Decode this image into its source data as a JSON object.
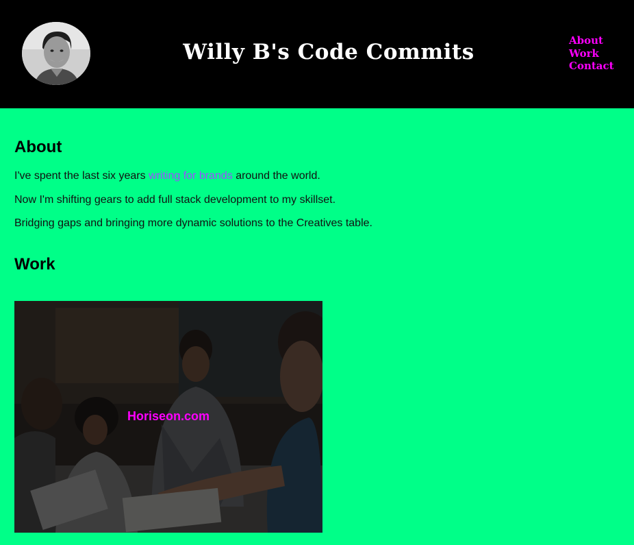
{
  "header": {
    "title": "Willy B's Code Commits",
    "avatar_icon": "profile-photo",
    "nav": [
      {
        "label": "About"
      },
      {
        "label": "Work"
      },
      {
        "label": "Contact"
      }
    ]
  },
  "about": {
    "heading": "About",
    "line1_before": "I've spent the last six years ",
    "line1_link": "writing for brands",
    "line1_after": " around the world.",
    "line2": "Now I'm shifting gears to add full stack development to my skillset.",
    "line3": "Bridging gaps and bringing more dynamic solutions to the Creatives table."
  },
  "work": {
    "heading": "Work",
    "cards": [
      {
        "label": "Horiseon.com",
        "image": "team-meeting-photo"
      }
    ]
  },
  "colors": {
    "page_bg": "#00ff88",
    "header_bg": "#000000",
    "accent": "#ff00ff",
    "link": "#9b4dff"
  }
}
